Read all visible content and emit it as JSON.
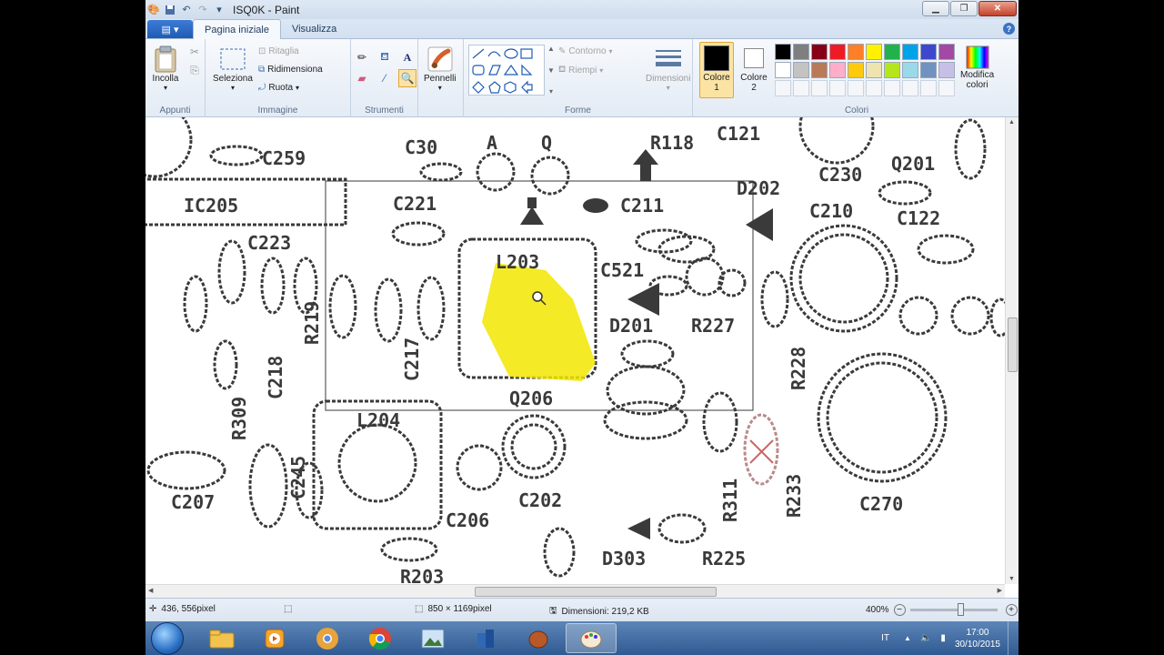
{
  "window": {
    "title": "ISQ0K - Paint"
  },
  "tabs": {
    "file_label": "▤ ▾",
    "home": "Pagina iniziale",
    "view": "Visualizza"
  },
  "ribbon": {
    "clipboard": {
      "paste": "Incolla",
      "group": "Appunti"
    },
    "image": {
      "select": "Seleziona",
      "crop": "Ritaglia",
      "resize": "Ridimensiona",
      "rotate": "Ruota",
      "group": "Immagine"
    },
    "tools": {
      "group": "Strumenti"
    },
    "brushes": {
      "label": "Pennelli"
    },
    "shapes": {
      "outline": "Contorno",
      "fill": "Riempi",
      "group": "Forme"
    },
    "size": {
      "label": "Dimensioni"
    },
    "colors": {
      "color1": "Colore",
      "color1_num": "1",
      "color2": "Colore",
      "color2_num": "2",
      "edit": "Modifica",
      "edit2": "colori",
      "group": "Colori",
      "color1_value": "#000000",
      "color2_value": "#ffffff",
      "palette": [
        "#000000",
        "#7f7f7f",
        "#880015",
        "#ed1c24",
        "#ff7f27",
        "#fff200",
        "#22b14c",
        "#00a2e8",
        "#3f48cc",
        "#a349a4",
        "#ffffff",
        "#c3c3c3",
        "#b97a57",
        "#ffaec9",
        "#ffc90e",
        "#efe4b0",
        "#b5e61d",
        "#99d9ea",
        "#7092be",
        "#c8bfe7"
      ]
    }
  },
  "canvas": {
    "labels": [
      "C259",
      "IC205",
      "C221",
      "C211",
      "D202",
      "C210",
      "C122",
      "C223",
      "L203",
      "C521",
      "D201",
      "R227",
      "C230",
      "Q201",
      "Q206",
      "L204",
      "C202",
      "C206",
      "D303",
      "R225",
      "C270",
      "C207",
      "R203",
      "R233",
      "R118",
      "C121",
      "A",
      "Q",
      "C30",
      "R311",
      "R228",
      "C217",
      "C218",
      "R219",
      "R309",
      "C245"
    ]
  },
  "status": {
    "cursor": "436, 556pixel",
    "image_size": "850 × 1169pixel",
    "file_size": "Dimensioni: 219,2 KB",
    "zoom": "400%"
  },
  "taskbar": {
    "lang": "IT",
    "time": "17:00",
    "date": "30/10/2015"
  }
}
